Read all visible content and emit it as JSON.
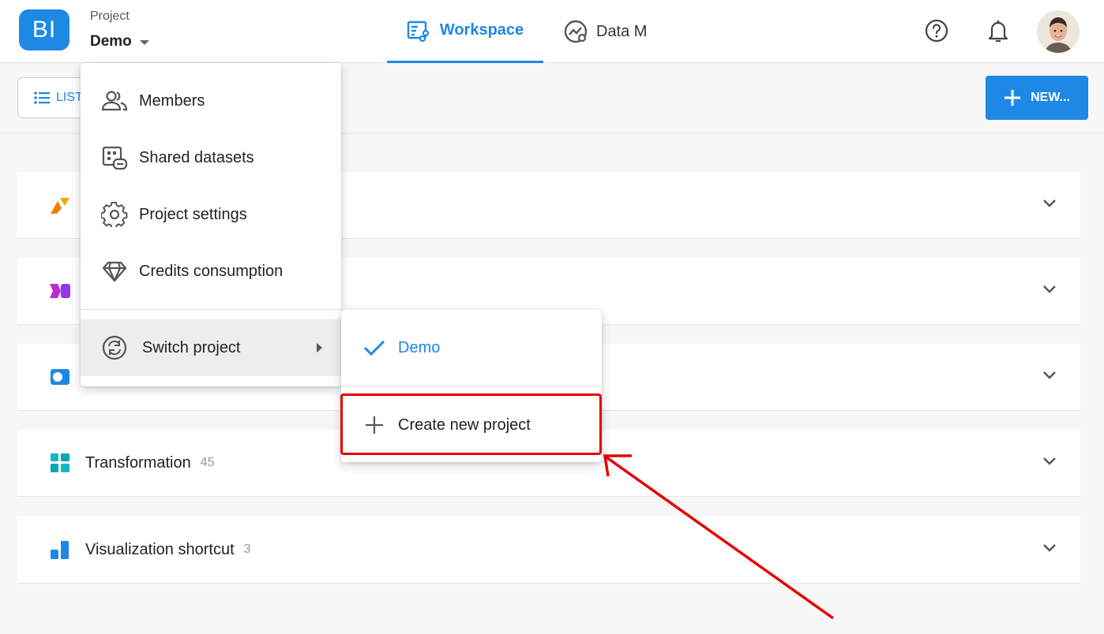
{
  "header": {
    "logo_text": "BI",
    "project_caption": "Project",
    "project_name": "Demo",
    "tabs": [
      {
        "label": "Workspace",
        "icon": "workspace-icon",
        "active": true
      },
      {
        "label": "Data M",
        "icon": "data-monitor-icon",
        "active": false
      }
    ],
    "help_icon": "help-circle-icon",
    "bell_icon": "bell-icon"
  },
  "toolbar": {
    "list_label": "LIST",
    "new_label": "NEW..."
  },
  "rows": [
    {
      "title": "",
      "count": "",
      "icon": "orange-connector-icon",
      "color": "#f57c00"
    },
    {
      "title": "",
      "count": "",
      "icon": "purple-flow-icon",
      "color": "#c026d3"
    },
    {
      "title": "",
      "count": "",
      "icon": "blue-storage-icon",
      "color": "#1e88e5"
    },
    {
      "title": "Transformation",
      "count": "45",
      "icon": "teal-grid-icon",
      "color": "#14b8c4"
    },
    {
      "title": "Visualization shortcut",
      "count": "3",
      "icon": "bar-chart-icon",
      "color": "#1e88e5"
    }
  ],
  "menu": {
    "items": [
      {
        "label": "Members",
        "icon": "members-icon"
      },
      {
        "label": "Shared datasets",
        "icon": "shared-datasets-icon"
      },
      {
        "label": "Project settings",
        "icon": "gear-icon"
      },
      {
        "label": "Credits consumption",
        "icon": "diamond-icon"
      }
    ],
    "switch_label": "Switch project",
    "switch_icon": "switch-project-icon"
  },
  "submenu": {
    "current_project": "Demo",
    "create_label": "Create new project"
  },
  "colors": {
    "accent": "#1e88e5",
    "highlight": "#e60000"
  }
}
